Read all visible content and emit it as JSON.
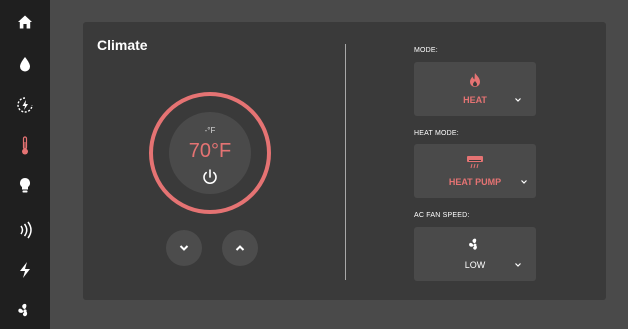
{
  "sidebar": {
    "items": [
      {
        "icon": "home-icon",
        "active": false
      },
      {
        "icon": "water-drop-icon",
        "active": false
      },
      {
        "icon": "eco-icon",
        "active": false
      },
      {
        "icon": "thermometer-icon",
        "active": true
      },
      {
        "icon": "lightbulb-icon",
        "active": false
      },
      {
        "icon": "signal-waves-icon",
        "active": false
      },
      {
        "icon": "lightning-bolt-icon",
        "active": false
      },
      {
        "icon": "fan-icon",
        "active": false
      }
    ]
  },
  "climate": {
    "title": "Climate",
    "unit": "-°F",
    "temperature": "70°F",
    "power_icon": "power-icon",
    "down_icon": "chevron-down-icon",
    "up_icon": "chevron-up-icon"
  },
  "mode": {
    "label": "MODE:",
    "value": "HEAT",
    "icon": "flame-icon"
  },
  "heat_mode": {
    "label": "HEAT MODE:",
    "value": "HEAT PUMP",
    "icon": "heat-pump-icon"
  },
  "fan_speed": {
    "label": "AC FAN SPEED:",
    "value": "LOW",
    "icon": "fan-icon"
  },
  "colors": {
    "accent": "#e57373",
    "sidebar_bg": "#1f1f1f",
    "page_bg": "#4a4a4a",
    "panel_bg": "#3a3a3a",
    "text": "#ffffff"
  }
}
